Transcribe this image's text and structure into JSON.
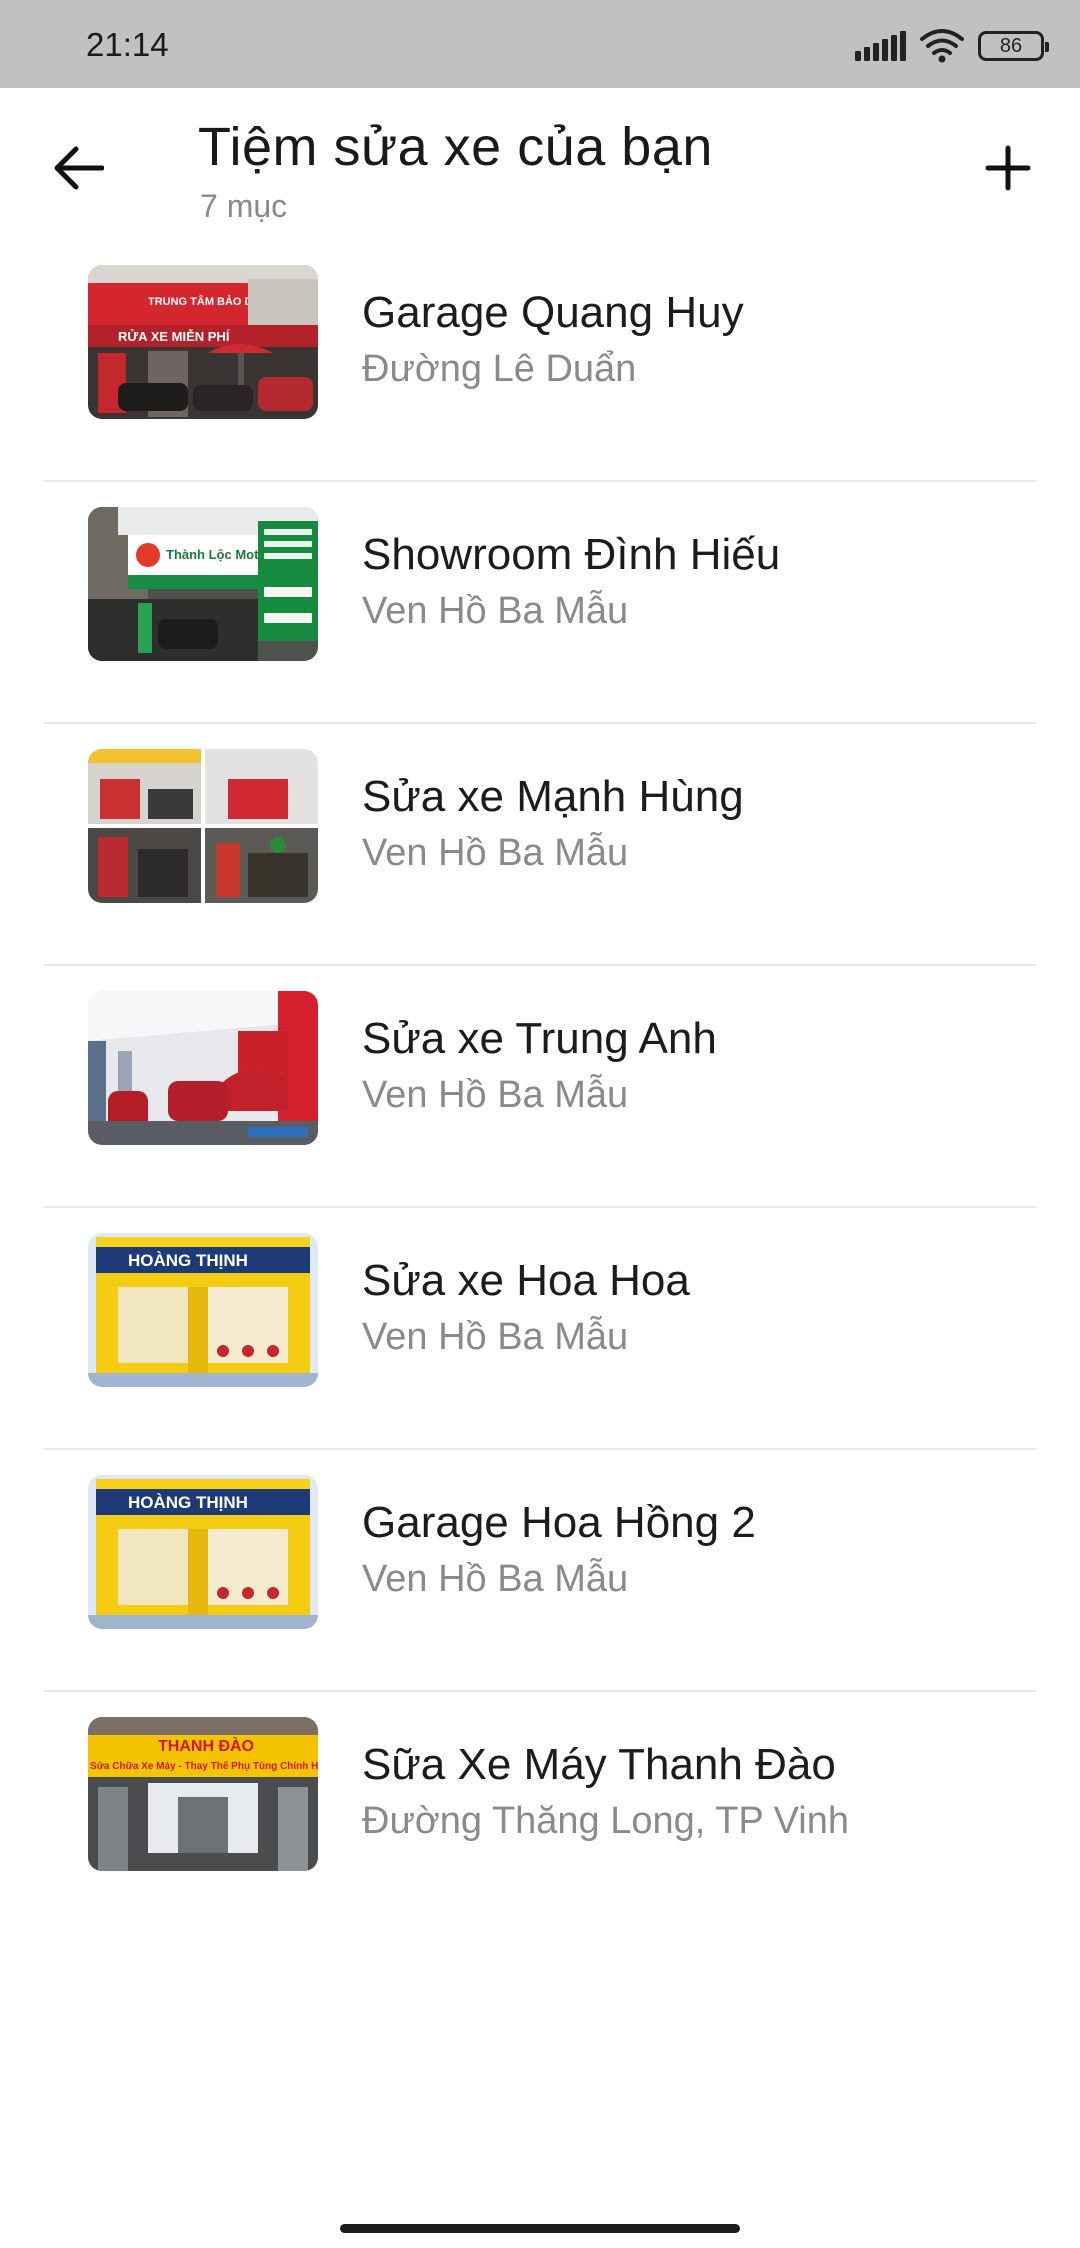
{
  "status_bar": {
    "time": "21:14",
    "battery_level": "86"
  },
  "header": {
    "title": "Tiệm sửa xe của bạn",
    "subtitle": "7 mục"
  },
  "shops": [
    {
      "name": "Garage Quang Huy",
      "address": "Đường Lê Duẩn"
    },
    {
      "name": "Showroom Đình Hiếu",
      "address": "Ven Hồ Ba Mẫu"
    },
    {
      "name": "Sửa xe Mạnh Hùng",
      "address": "Ven Hồ Ba Mẫu"
    },
    {
      "name": "Sửa xe Trung Anh",
      "address": "Ven Hồ Ba Mẫu"
    },
    {
      "name": "Sửa xe Hoa Hoa",
      "address": "Ven Hồ Ba Mẫu"
    },
    {
      "name": "Garage Hoa Hồng 2",
      "address": "Ven Hồ Ba Mẫu"
    },
    {
      "name": "Sữa Xe Máy Thanh Đào",
      "address": "Đường Thăng Long, TP Vinh"
    }
  ],
  "thumbnail_text": {
    "hoang_thinh_sign": "HOÀNG THỊNH",
    "thanh_dao_sign": "THANH ĐÀO",
    "thanh_dao_subsign": "Sửa Chữa Xe Máy - Thay Thế Phụ Tùng Chính Hãng",
    "thanh_loc_sign": "Thành Lộc Motor",
    "quang_huy_sign": "TRUNG TÂM BẢO DƯỠNG",
    "quang_huy_subsign": "RỬA XE MIỄN PHÍ"
  },
  "colors": {
    "status_bar": "#c1c1c1",
    "divider": "#e8e8e8",
    "secondary_text": "#8a8a8a"
  }
}
